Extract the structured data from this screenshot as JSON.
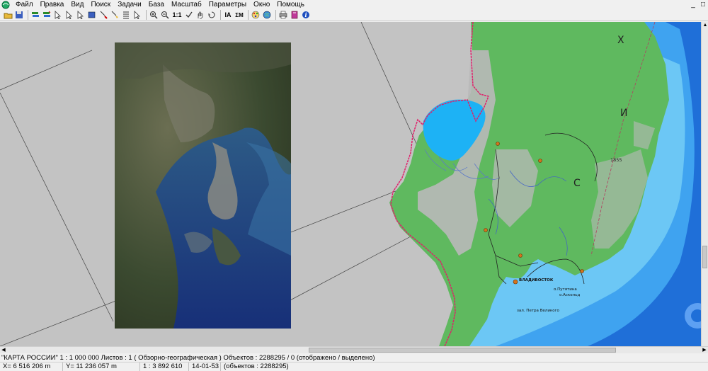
{
  "menu": {
    "items": [
      "Файл",
      "Правка",
      "Вид",
      "Поиск",
      "Задачи",
      "База",
      "Масштаб",
      "Параметры",
      "Окно",
      "Помощь"
    ]
  },
  "window_controls": [
    "_",
    "□"
  ],
  "toolbar": {
    "zoom_reset_label": "1:1"
  },
  "map": {
    "labels": {
      "ch1": "Х",
      "ch2": "С",
      "ch3": "И",
      "elev": "1855",
      "city": "ВЛАДИВОСТОК",
      "isl1": "о.Путятина",
      "isl2": "о.Аскольд",
      "bay": "зал. Петра Великого"
    },
    "colors": {
      "land": "#5fb95f",
      "sea_light": "#6cc7f5",
      "sea_mid": "#3fa3f0",
      "sea_deep": "#1f6fd8",
      "lake": "#1db2f5",
      "border": "#e0206a",
      "background": "#c3c3c3"
    }
  },
  "status": {
    "line1": "\"КАРТА РОССИИ\"  1 : 1 000 000   Листов : 1   ( Обзорно-географическая )  Объектов : 2288295 / 0 (отображено / выделено)",
    "x_label": "X=",
    "x_value": "6 516 206 m",
    "y_label": "Y=",
    "y_value": "11 236 057 m",
    "scale": "1 : 3 892 610",
    "time": "14-01-53",
    "objects": "(объектов : 2288295)"
  }
}
